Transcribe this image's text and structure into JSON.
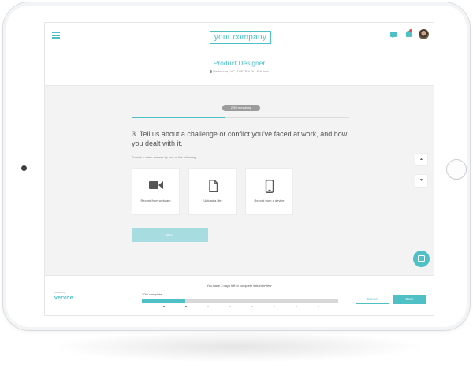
{
  "header": {
    "logo_text": "your company",
    "job_title": "Product Designer",
    "job_meta": "Melbourne, VIC, AUSTRALIA  ·  Full time"
  },
  "question": {
    "timer": "2:55 remaining",
    "time_progress": 0.43,
    "text": "3. Tell us about a challenge or conflict you've faced at work, and how you dealt with it.",
    "instruction": "Submit a video answer by one of the following",
    "options": [
      {
        "label": "Record from webcam",
        "icon": "video-camera-icon"
      },
      {
        "label": "Upload a file",
        "icon": "file-icon"
      },
      {
        "label": "Record from a device",
        "icon": "mobile-device-icon"
      }
    ],
    "next_label": "Next"
  },
  "side_controls": {
    "up_glyph": "▲",
    "down_glyph": "▼"
  },
  "footer": {
    "brand_small": "Powered by",
    "brand": "vervoe",
    "deadline": "You have 3 days left to complete this interview",
    "complete_label": "20% complete",
    "overall_progress": 0.22,
    "steps_total": 8,
    "steps_done": 2,
    "cancel_label": "Cancel",
    "save_label": "Save"
  },
  "colors": {
    "accent": "#4fc0c6",
    "accent_light": "#a7dde0",
    "notification": "#e05a4a"
  }
}
